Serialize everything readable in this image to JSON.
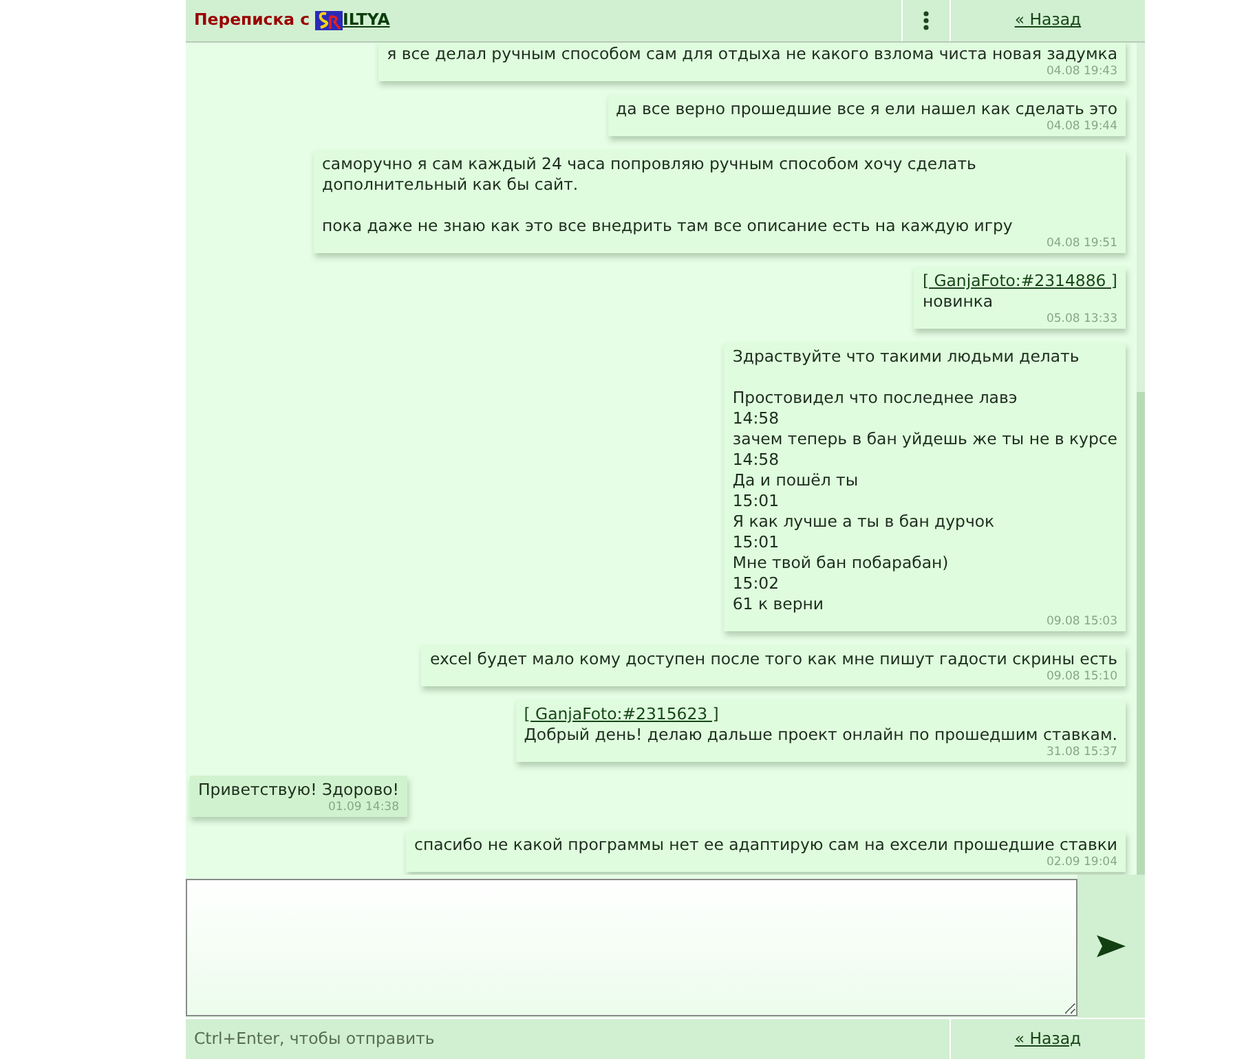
{
  "header": {
    "title": "Переписка с",
    "username": "ILTYA",
    "back_link": "« Назад"
  },
  "messages": [
    {
      "outgoing": true,
      "text": "я все делал ручным способом сам для отдыха не какого взлома чиста новая задумка",
      "time": "04.08 19:43"
    },
    {
      "outgoing": true,
      "text": "да все верно прошедшие все я ели нашел как сделать это",
      "time": "04.08 19:44"
    },
    {
      "outgoing": true,
      "text": "саморучно я сам каждый 24 часа попровляю ручным способом хочу сделать дополнительный как бы сайт.\n\nпока даже не знаю как это все внедрить там все описание есть на каждую игру",
      "time": "04.08 19:51"
    },
    {
      "outgoing": true,
      "quote": "[ GanjaFoto:#2314886 ]",
      "text": "новинка",
      "time": "05.08 13:33"
    },
    {
      "outgoing": true,
      "text": "Здраствуйте что такими людьми делать\n\nПростовидел что последнее лавэ\n14:58\nзачем теперь в бан уйдешь же ты не в курсе\n14:58\nДа и пошёл ты\n15:01\nЯ как лучше а ты в бан дурчок\n15:01\nМне твой бан побарабан)\n15:02\n61 к верни",
      "time": "09.08 15:03"
    },
    {
      "outgoing": true,
      "text": "excel будет мало кому доступен после того как мне пишут гадости скрины есть",
      "time": "09.08 15:10"
    },
    {
      "outgoing": true,
      "quote": "[ GanjaFoto:#2315623 ]",
      "text": "Добрый день! делаю дальше проект онлайн по прошедшим ставкам.",
      "time": "31.08 15:37"
    },
    {
      "outgoing": false,
      "text": "Приветствую! Здорово!",
      "time": "01.09 14:38"
    },
    {
      "outgoing": true,
      "text": "спасибо не какой программы нет ее адаптирую сам на excели прошедшие ставки",
      "time": "02.09 19:04"
    }
  ],
  "footer": {
    "hint": "Ctrl+Enter, чтобы отправить",
    "back_link": "« Назад"
  }
}
